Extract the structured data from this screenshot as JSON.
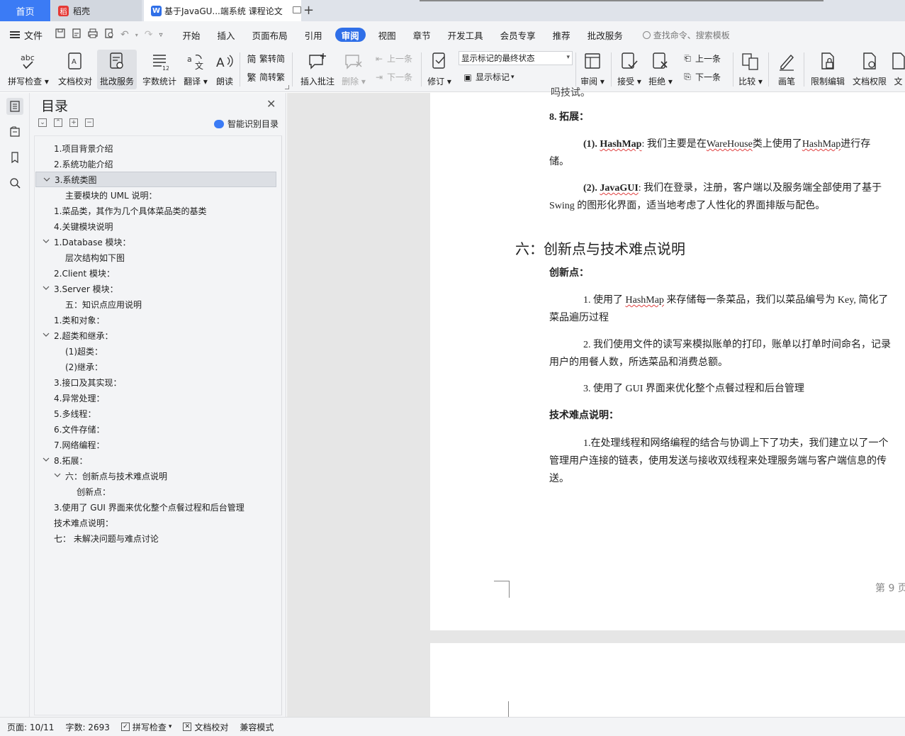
{
  "tabs": {
    "home": "首页",
    "daoke": "稻壳",
    "doc": "基于JavaGU...端系统 课程论文",
    "add": "+"
  },
  "menubar": {
    "file": "文件",
    "tabs": [
      "开始",
      "插入",
      "页面布局",
      "引用",
      "审阅",
      "视图",
      "章节",
      "开发工具",
      "会员专享",
      "推荐",
      "批改服务"
    ],
    "active_tab": "审阅",
    "search_placeholder": "查找命令、搜索模板"
  },
  "ribbon": {
    "spellcheck": "拼写检查",
    "doc_proof": "文档校对",
    "grading": "批改服务",
    "word_count": "字数统计",
    "translate": "翻译",
    "read_aloud": "朗读",
    "trad_to_simp": "繁转简",
    "simp_to_trad": "简转繁",
    "insert_comment": "插入批注",
    "delete": "删除",
    "prev_comment": "上一条",
    "next_comment": "下一条",
    "track_changes": "修订",
    "markup_state": "显示标记的最终状态",
    "show_markup": "显示标记",
    "review": "审阅",
    "accept": "接受",
    "reject": "拒绝",
    "prev_change": "上一条",
    "next_change": "下一条",
    "compare": "比较",
    "pen": "画笔",
    "restrict_edit": "限制编辑",
    "doc_permission": "文档权限",
    "doc_more": "文"
  },
  "toc": {
    "title": "目录",
    "smart_detect": "智能识别目录",
    "items": [
      {
        "label": "1.项目背景介绍",
        "indent": 1,
        "chev": false
      },
      {
        "label": "2.系统功能介绍",
        "indent": 1,
        "chev": false
      },
      {
        "label": "3.系统类图",
        "indent": 1,
        "chev": true
      },
      {
        "label": "主要模块的 UML 说明：",
        "indent": 2,
        "chev": false
      },
      {
        "label": "1.菜品类，其作为几个具体菜品类的基类",
        "indent": 1,
        "chev": false
      },
      {
        "label": "4.关键模块说明",
        "indent": 1,
        "chev": false
      },
      {
        "label": "1.Database 模块：",
        "indent": 1,
        "chev": true
      },
      {
        "label": "层次结构如下图",
        "indent": 2,
        "chev": false
      },
      {
        "label": "2.Client 模块：",
        "indent": 1,
        "chev": false
      },
      {
        "label": "3.Server 模块：",
        "indent": 1,
        "chev": true
      },
      {
        "label": "五：知识点应用说明",
        "indent": 2,
        "chev": false
      },
      {
        "label": "1.类和对象：",
        "indent": 1,
        "chev": false
      },
      {
        "label": "2.超类和继承：",
        "indent": 1,
        "chev": true
      },
      {
        "label": "(1)超类：",
        "indent": 2,
        "chev": false
      },
      {
        "label": "(2)继承：",
        "indent": 2,
        "chev": false
      },
      {
        "label": "3.接口及其实现：",
        "indent": 1,
        "chev": false
      },
      {
        "label": "4.异常处理：",
        "indent": 1,
        "chev": false
      },
      {
        "label": "5.多线程：",
        "indent": 1,
        "chev": false
      },
      {
        "label": "6.文件存储：",
        "indent": 1,
        "chev": false
      },
      {
        "label": "7.网络编程：",
        "indent": 1,
        "chev": false
      },
      {
        "label": "8.拓展：",
        "indent": 1,
        "chev": true
      },
      {
        "label": "六：创新点与技术难点说明",
        "indent": 2,
        "chev": true
      },
      {
        "label": "创新点：",
        "indent": 3,
        "chev": false
      },
      {
        "label": "3.使用了 GUI 界面来优化整个点餐过程和后台管理",
        "indent": 1,
        "chev": false
      },
      {
        "label": "技术难点说明：",
        "indent": 1,
        "chev": false
      },
      {
        "label": "七：  未解决问题与难点讨论",
        "indent": 1,
        "chev": false
      }
    ],
    "selected_index": 2
  },
  "document": {
    "top_cut": "吗技试。",
    "s8_title": "8. 拓展：",
    "p1_num": "(1).",
    "p1_term": "HashMap",
    "p1_a": ": 我们主要是在",
    "p1_warehouse": "WareHouse",
    "p1_b": "类上使用了",
    "p1_hashmap2": "HashMap",
    "p1_c": "进行存",
    "p1_line2": "储。",
    "p2_num": "(2).",
    "p2_term": "JavaGUI",
    "p2_a": ": 我们在登录，注册，客户端以及服务端全部使用了基于",
    "p2_line2": "Swing 的图形化界面，适当地考虑了人性化的界面排版与配色。",
    "heading6": "六：创新点与技术难点说明",
    "innovation_title": "创新点：",
    "i1_a": "1. 使用了",
    "i1_hm": "HashMap",
    "i1_b": "来存储每一条菜品，我们以菜品编号为 Key, 简化了",
    "i1_line2": "菜品遍历过程",
    "i2_line1": "2. 我们使用文件的读写来模拟账单的打印，账单以打单时间命名，记录",
    "i2_line2": "用户的用餐人数，所选菜品和消费总额。",
    "i3": "3. 使用了 GUI 界面来优化整个点餐过程和后台管理",
    "tech_title": "技术难点说明：",
    "t1_line1": "1.在处理线程和网络编程的结合与协调上下了功夫，我们建立以了一个",
    "t1_line2": "管理用户连接的链表，使用发送与接收双线程来处理服务端与客户端信息的传",
    "t1_line3": "送。",
    "page_num": "第 9 页"
  },
  "status": {
    "page": "页面: 10/11",
    "words": "字数: 2693",
    "spellcheck": "拼写检查",
    "doc_proof": "文档校对",
    "compat": "兼容模式"
  }
}
